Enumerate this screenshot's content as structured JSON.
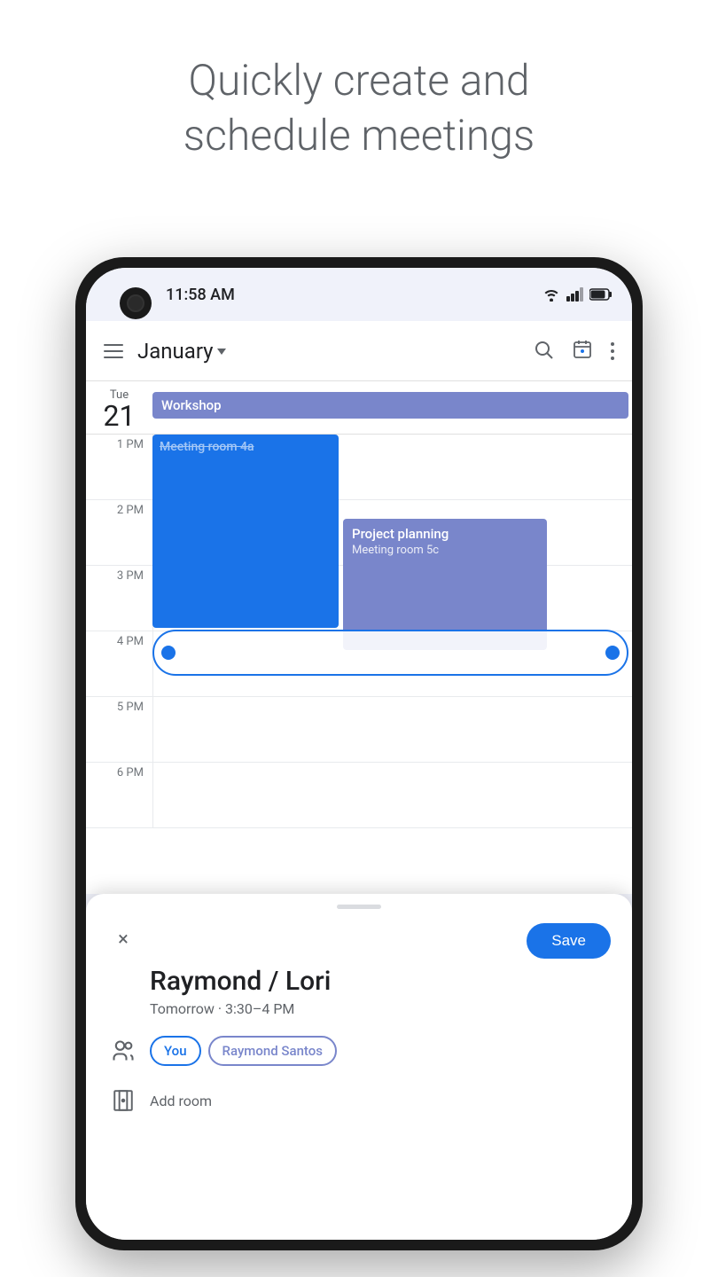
{
  "header": {
    "title": "Quickly create and",
    "subtitle": "schedule meetings"
  },
  "status_bar": {
    "time": "11:58 AM"
  },
  "toolbar": {
    "month": "January",
    "search_label": "Search",
    "calendar_label": "Calendar",
    "more_label": "More options"
  },
  "calendar": {
    "day_name": "Tue",
    "day_number": "21",
    "all_day_event": "Workshop",
    "times": [
      "1 PM",
      "2 PM",
      "3 PM",
      "4 PM",
      "5 PM",
      "6 PM"
    ],
    "events": [
      {
        "title": "Meeting room 4a",
        "type": "blue",
        "time": "1PM"
      },
      {
        "title": "Project planning",
        "subtitle": "Meeting room 5c",
        "type": "purple",
        "time": "2PM"
      }
    ]
  },
  "bottom_sheet": {
    "close_label": "×",
    "save_label": "Save",
    "meeting_title": "Raymond / Lori",
    "meeting_time": "Tomorrow · 3:30–4 PM",
    "attendees": [
      {
        "label": "You",
        "type": "you"
      },
      {
        "label": "Raymond Santos",
        "type": "raymond"
      }
    ],
    "add_room_label": "Add room"
  }
}
